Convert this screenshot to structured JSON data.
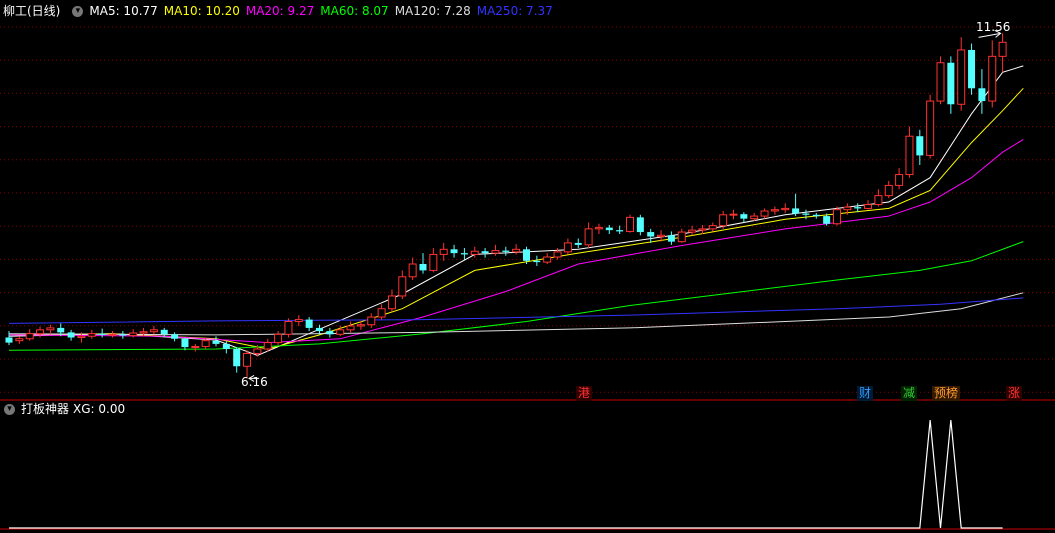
{
  "header": {
    "title": "柳工(日线)",
    "ma_items": [
      {
        "label": "MA5: 10.77",
        "color": "#ffffff"
      },
      {
        "label": "MA10: 10.20",
        "color": "#ffff00"
      },
      {
        "label": "MA20: 9.27",
        "color": "#ff00ff"
      },
      {
        "label": "MA60: 8.07",
        "color": "#00ff00"
      },
      {
        "label": "MA120: 7.28",
        "color": "#dddddd"
      },
      {
        "label": "MA250: 7.37",
        "color": "#3333ff"
      }
    ]
  },
  "sub_header": {
    "title": "打板神器",
    "value": "XG: 0.00"
  },
  "markers": [
    {
      "text": "港",
      "color": "#ff3333",
      "bg": "#330000"
    },
    {
      "text": "财",
      "color": "#3399ff",
      "bg": "#001a33"
    },
    {
      "text": "减",
      "color": "#33cc33",
      "bg": "#002200"
    },
    {
      "text": "预榜",
      "color": "#ff9933",
      "bg": "#331a00"
    },
    {
      "text": "涨",
      "color": "#ff3333",
      "bg": "#330000"
    }
  ],
  "annotations": {
    "high": "11.56",
    "low": "6.16"
  },
  "colors": {
    "up": "#ff3232",
    "down": "#54ffff",
    "grid": "#8b0000",
    "sep": "#c80000"
  },
  "chart_data": {
    "type": "candlestick",
    "price_range": [
      5.9,
      11.8
    ],
    "highest": 11.56,
    "lowest": 6.16,
    "candles": [
      [
        6.8,
        6.72,
        6.9,
        6.68
      ],
      [
        6.75,
        6.78,
        6.82,
        6.7
      ],
      [
        6.78,
        6.86,
        6.93,
        6.75
      ],
      [
        6.86,
        6.92,
        6.97,
        6.8
      ],
      [
        6.92,
        6.95,
        7.0,
        6.85
      ],
      [
        6.95,
        6.88,
        7.02,
        6.82
      ],
      [
        6.88,
        6.8,
        6.92,
        6.75
      ],
      [
        6.8,
        6.82,
        6.88,
        6.72
      ],
      [
        6.82,
        6.86,
        6.92,
        6.78
      ],
      [
        6.86,
        6.84,
        6.94,
        6.8
      ],
      [
        6.84,
        6.85,
        6.9,
        6.8
      ],
      [
        6.85,
        6.83,
        6.9,
        6.78
      ],
      [
        6.83,
        6.87,
        6.93,
        6.8
      ],
      [
        6.87,
        6.89,
        6.95,
        6.82
      ],
      [
        6.89,
        6.92,
        6.98,
        6.85
      ],
      [
        6.92,
        6.85,
        6.95,
        6.8
      ],
      [
        6.85,
        6.78,
        6.88,
        6.74
      ],
      [
        6.78,
        6.65,
        6.8,
        6.6
      ],
      [
        6.65,
        6.66,
        6.7,
        6.58
      ],
      [
        6.66,
        6.75,
        6.8,
        6.62
      ],
      [
        6.75,
        6.7,
        6.82,
        6.66
      ],
      [
        6.7,
        6.62,
        6.74,
        6.55
      ],
      [
        6.62,
        6.35,
        6.65,
        6.25
      ],
      [
        6.35,
        6.55,
        6.6,
        6.16
      ],
      [
        6.55,
        6.62,
        6.68,
        6.5
      ],
      [
        6.62,
        6.72,
        6.78,
        6.58
      ],
      [
        6.72,
        6.85,
        6.9,
        6.68
      ],
      [
        6.85,
        7.05,
        7.1,
        6.8
      ],
      [
        7.05,
        7.08,
        7.15,
        6.98
      ],
      [
        7.08,
        6.95,
        7.12,
        6.9
      ],
      [
        6.95,
        6.9,
        7.0,
        6.85
      ],
      [
        6.9,
        6.85,
        6.95,
        6.8
      ],
      [
        6.85,
        6.92,
        6.98,
        6.82
      ],
      [
        6.92,
        6.98,
        7.05,
        6.88
      ],
      [
        6.98,
        7.0,
        7.06,
        6.92
      ],
      [
        7.0,
        7.12,
        7.18,
        6.95
      ],
      [
        7.12,
        7.25,
        7.32,
        7.08
      ],
      [
        7.25,
        7.45,
        7.55,
        7.2
      ],
      [
        7.45,
        7.75,
        7.85,
        7.4
      ],
      [
        7.75,
        7.95,
        8.05,
        7.7
      ],
      [
        7.95,
        7.85,
        8.12,
        7.8
      ],
      [
        7.85,
        8.1,
        8.2,
        7.82
      ],
      [
        8.1,
        8.18,
        8.28,
        8.0
      ],
      [
        8.18,
        8.12,
        8.25,
        8.05
      ],
      [
        8.12,
        8.1,
        8.2,
        8.02
      ],
      [
        8.1,
        8.15,
        8.22,
        8.05
      ],
      [
        8.15,
        8.12,
        8.2,
        8.05
      ],
      [
        8.12,
        8.16,
        8.25,
        8.08
      ],
      [
        8.16,
        8.14,
        8.22,
        8.08
      ],
      [
        8.14,
        8.18,
        8.26,
        8.1
      ],
      [
        8.18,
        8.0,
        8.22,
        7.95
      ],
      [
        8.0,
        7.98,
        8.08,
        7.92
      ],
      [
        7.98,
        8.06,
        8.12,
        7.95
      ],
      [
        8.06,
        8.14,
        8.2,
        8.02
      ],
      [
        8.14,
        8.28,
        8.35,
        8.1
      ],
      [
        8.28,
        8.25,
        8.35,
        8.2
      ],
      [
        8.25,
        8.5,
        8.6,
        8.2
      ],
      [
        8.5,
        8.52,
        8.58,
        8.42
      ],
      [
        8.52,
        8.48,
        8.56,
        8.42
      ],
      [
        8.48,
        8.46,
        8.55,
        8.42
      ],
      [
        8.46,
        8.68,
        8.72,
        8.44
      ],
      [
        8.68,
        8.45,
        8.72,
        8.4
      ],
      [
        8.45,
        8.38,
        8.5,
        8.28
      ],
      [
        8.38,
        8.4,
        8.48,
        8.3
      ],
      [
        8.4,
        8.3,
        8.46,
        8.25
      ],
      [
        8.3,
        8.45,
        8.5,
        8.28
      ],
      [
        8.45,
        8.48,
        8.55,
        8.4
      ],
      [
        8.48,
        8.5,
        8.56,
        8.42
      ],
      [
        8.5,
        8.55,
        8.6,
        8.46
      ],
      [
        8.55,
        8.72,
        8.78,
        8.5
      ],
      [
        8.72,
        8.73,
        8.8,
        8.65
      ],
      [
        8.73,
        8.66,
        8.76,
        8.6
      ],
      [
        8.66,
        8.7,
        8.75,
        8.62
      ],
      [
        8.7,
        8.78,
        8.82,
        8.66
      ],
      [
        8.78,
        8.8,
        8.85,
        8.72
      ],
      [
        8.8,
        8.82,
        8.9,
        8.75
      ],
      [
        8.82,
        8.74,
        9.05,
        8.7
      ],
      [
        8.74,
        8.72,
        8.8,
        8.65
      ],
      [
        8.72,
        8.7,
        8.75,
        8.66
      ],
      [
        8.7,
        8.58,
        8.74,
        8.55
      ],
      [
        8.58,
        8.8,
        8.85,
        8.55
      ],
      [
        8.8,
        8.84,
        8.9,
        8.72
      ],
      [
        8.84,
        8.82,
        8.9,
        8.76
      ],
      [
        8.82,
        8.88,
        8.95,
        8.8
      ],
      [
        8.88,
        9.02,
        9.12,
        8.85
      ],
      [
        9.02,
        9.18,
        9.25,
        8.98
      ],
      [
        9.18,
        9.35,
        9.45,
        9.12
      ],
      [
        9.35,
        9.95,
        10.1,
        9.3
      ],
      [
        9.95,
        9.65,
        10.05,
        9.5
      ],
      [
        9.65,
        10.5,
        10.6,
        9.6
      ],
      [
        10.5,
        11.1,
        11.2,
        10.45
      ],
      [
        11.1,
        10.45,
        11.2,
        10.3
      ],
      [
        10.45,
        11.3,
        11.5,
        10.35
      ],
      [
        11.3,
        10.7,
        11.4,
        10.6
      ],
      [
        10.7,
        10.5,
        11.0,
        10.3
      ],
      [
        10.5,
        11.2,
        11.45,
        10.4
      ],
      [
        11.2,
        11.42,
        11.56,
        10.95
      ]
    ],
    "ma": {
      "MA5": [
        [
          0,
          6.82
        ],
        [
          10,
          6.86
        ],
        [
          20,
          6.76
        ],
        [
          24,
          6.52
        ],
        [
          30,
          6.93
        ],
        [
          38,
          7.48
        ],
        [
          45,
          8.1
        ],
        [
          55,
          8.18
        ],
        [
          65,
          8.42
        ],
        [
          75,
          8.72
        ],
        [
          85,
          8.92
        ],
        [
          89,
          9.3
        ],
        [
          93,
          10.3
        ],
        [
          96,
          10.95
        ],
        [
          98,
          11.05
        ]
      ],
      "MA10": [
        [
          0,
          6.84
        ],
        [
          10,
          6.86
        ],
        [
          20,
          6.78
        ],
        [
          25,
          6.62
        ],
        [
          30,
          6.84
        ],
        [
          38,
          7.25
        ],
        [
          45,
          7.85
        ],
        [
          55,
          8.12
        ],
        [
          65,
          8.37
        ],
        [
          75,
          8.65
        ],
        [
          85,
          8.82
        ],
        [
          89,
          9.1
        ],
        [
          93,
          9.85
        ],
        [
          96,
          10.35
        ],
        [
          98,
          10.7
        ]
      ],
      "MA20": [
        [
          0,
          6.84
        ],
        [
          15,
          6.82
        ],
        [
          25,
          6.72
        ],
        [
          32,
          6.78
        ],
        [
          40,
          7.12
        ],
        [
          48,
          7.52
        ],
        [
          55,
          7.95
        ],
        [
          65,
          8.24
        ],
        [
          75,
          8.5
        ],
        [
          85,
          8.7
        ],
        [
          89,
          8.92
        ],
        [
          93,
          9.3
        ],
        [
          96,
          9.7
        ],
        [
          98,
          9.9
        ]
      ],
      "MA60": [
        [
          0,
          6.6
        ],
        [
          20,
          6.62
        ],
        [
          30,
          6.7
        ],
        [
          40,
          6.86
        ],
        [
          50,
          7.05
        ],
        [
          60,
          7.3
        ],
        [
          70,
          7.5
        ],
        [
          80,
          7.7
        ],
        [
          88,
          7.85
        ],
        [
          93,
          8.0
        ],
        [
          98,
          8.3
        ]
      ],
      "MA120": [
        [
          0,
          6.86
        ],
        [
          20,
          6.84
        ],
        [
          40,
          6.88
        ],
        [
          60,
          6.95
        ],
        [
          75,
          7.05
        ],
        [
          85,
          7.12
        ],
        [
          92,
          7.25
        ],
        [
          98,
          7.5
        ]
      ],
      "MA250": [
        [
          0,
          7.02
        ],
        [
          20,
          7.06
        ],
        [
          40,
          7.08
        ],
        [
          60,
          7.15
        ],
        [
          80,
          7.25
        ],
        [
          90,
          7.32
        ],
        [
          98,
          7.42
        ]
      ]
    },
    "xg_indicator": {
      "spikes_at": [
        89,
        91
      ],
      "value": 0.0,
      "peak": 1.0
    }
  }
}
